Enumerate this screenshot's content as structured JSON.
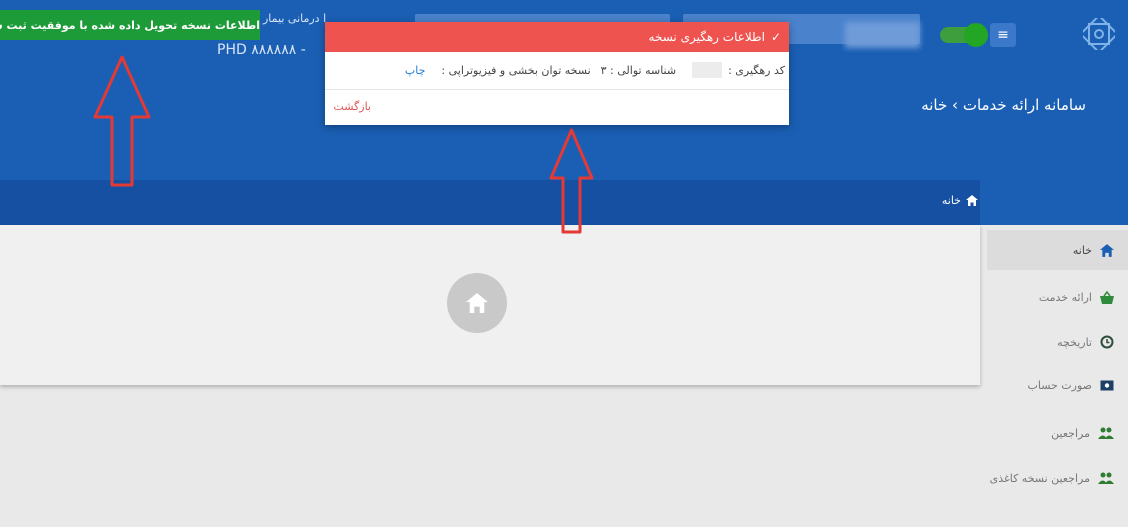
{
  "header": {
    "title": "سامانه ارائه خدمات",
    "title_separator": "›",
    "title_current": "خانه",
    "top_left_text": "ا درمانی بیمار",
    "top_left_code": "PHD ۸۸۸۸۸۸ -",
    "menu_icon": "hamburger-icon",
    "logo_icon": "organization-logo"
  },
  "breadcrumb": {
    "home_label": "خانه",
    "icon": "home-icon"
  },
  "toast": {
    "text": "اطلاعات نسخه تحویل داده شده با موفقیت ثبت ش",
    "icon": "check-icon",
    "color": "#1e9b39"
  },
  "dialog": {
    "title": "اطلاعات رهگیری نسخه",
    "tracking_code_label": "کد رهگیری :",
    "queue_id_label": "شناسه توالی : ۳",
    "prescription_type": "نسخه توان بخشی و فیزیوتراپی :",
    "print_label": "چاپ",
    "back_label": "بازگشت",
    "header_color": "#ef5350"
  },
  "sidebar": {
    "items": [
      {
        "label": "خانه",
        "icon": "home-icon"
      },
      {
        "label": "ارائه خدمت",
        "icon": "basket-icon"
      },
      {
        "label": "تاریخچه",
        "icon": "history-icon"
      },
      {
        "label": "صورت حساب",
        "icon": "money-icon"
      },
      {
        "label": "مراجعین",
        "icon": "people-icon"
      },
      {
        "label": "مراجعین نسخه کاغذی",
        "icon": "people-icon"
      }
    ]
  },
  "colors": {
    "header_blue": "#1a5fb4",
    "arrow_red": "#e53935"
  }
}
